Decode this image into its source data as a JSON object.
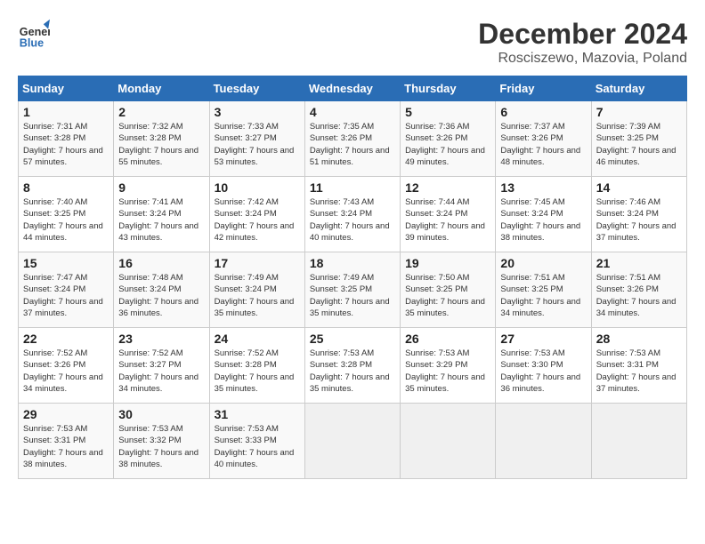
{
  "header": {
    "logo_line1": "General",
    "logo_line2": "Blue",
    "month": "December 2024",
    "location": "Rosciszewo, Mazovia, Poland"
  },
  "weekdays": [
    "Sunday",
    "Monday",
    "Tuesday",
    "Wednesday",
    "Thursday",
    "Friday",
    "Saturday"
  ],
  "weeks": [
    [
      {
        "day": "1",
        "sunrise": "7:31 AM",
        "sunset": "3:28 PM",
        "daylight": "7 hours and 57 minutes."
      },
      {
        "day": "2",
        "sunrise": "7:32 AM",
        "sunset": "3:28 PM",
        "daylight": "7 hours and 55 minutes."
      },
      {
        "day": "3",
        "sunrise": "7:33 AM",
        "sunset": "3:27 PM",
        "daylight": "7 hours and 53 minutes."
      },
      {
        "day": "4",
        "sunrise": "7:35 AM",
        "sunset": "3:26 PM",
        "daylight": "7 hours and 51 minutes."
      },
      {
        "day": "5",
        "sunrise": "7:36 AM",
        "sunset": "3:26 PM",
        "daylight": "7 hours and 49 minutes."
      },
      {
        "day": "6",
        "sunrise": "7:37 AM",
        "sunset": "3:26 PM",
        "daylight": "7 hours and 48 minutes."
      },
      {
        "day": "7",
        "sunrise": "7:39 AM",
        "sunset": "3:25 PM",
        "daylight": "7 hours and 46 minutes."
      }
    ],
    [
      {
        "day": "8",
        "sunrise": "7:40 AM",
        "sunset": "3:25 PM",
        "daylight": "7 hours and 44 minutes."
      },
      {
        "day": "9",
        "sunrise": "7:41 AM",
        "sunset": "3:24 PM",
        "daylight": "7 hours and 43 minutes."
      },
      {
        "day": "10",
        "sunrise": "7:42 AM",
        "sunset": "3:24 PM",
        "daylight": "7 hours and 42 minutes."
      },
      {
        "day": "11",
        "sunrise": "7:43 AM",
        "sunset": "3:24 PM",
        "daylight": "7 hours and 40 minutes."
      },
      {
        "day": "12",
        "sunrise": "7:44 AM",
        "sunset": "3:24 PM",
        "daylight": "7 hours and 39 minutes."
      },
      {
        "day": "13",
        "sunrise": "7:45 AM",
        "sunset": "3:24 PM",
        "daylight": "7 hours and 38 minutes."
      },
      {
        "day": "14",
        "sunrise": "7:46 AM",
        "sunset": "3:24 PM",
        "daylight": "7 hours and 37 minutes."
      }
    ],
    [
      {
        "day": "15",
        "sunrise": "7:47 AM",
        "sunset": "3:24 PM",
        "daylight": "7 hours and 37 minutes."
      },
      {
        "day": "16",
        "sunrise": "7:48 AM",
        "sunset": "3:24 PM",
        "daylight": "7 hours and 36 minutes."
      },
      {
        "day": "17",
        "sunrise": "7:49 AM",
        "sunset": "3:24 PM",
        "daylight": "7 hours and 35 minutes."
      },
      {
        "day": "18",
        "sunrise": "7:49 AM",
        "sunset": "3:25 PM",
        "daylight": "7 hours and 35 minutes."
      },
      {
        "day": "19",
        "sunrise": "7:50 AM",
        "sunset": "3:25 PM",
        "daylight": "7 hours and 35 minutes."
      },
      {
        "day": "20",
        "sunrise": "7:51 AM",
        "sunset": "3:25 PM",
        "daylight": "7 hours and 34 minutes."
      },
      {
        "day": "21",
        "sunrise": "7:51 AM",
        "sunset": "3:26 PM",
        "daylight": "7 hours and 34 minutes."
      }
    ],
    [
      {
        "day": "22",
        "sunrise": "7:52 AM",
        "sunset": "3:26 PM",
        "daylight": "7 hours and 34 minutes."
      },
      {
        "day": "23",
        "sunrise": "7:52 AM",
        "sunset": "3:27 PM",
        "daylight": "7 hours and 34 minutes."
      },
      {
        "day": "24",
        "sunrise": "7:52 AM",
        "sunset": "3:28 PM",
        "daylight": "7 hours and 35 minutes."
      },
      {
        "day": "25",
        "sunrise": "7:53 AM",
        "sunset": "3:28 PM",
        "daylight": "7 hours and 35 minutes."
      },
      {
        "day": "26",
        "sunrise": "7:53 AM",
        "sunset": "3:29 PM",
        "daylight": "7 hours and 35 minutes."
      },
      {
        "day": "27",
        "sunrise": "7:53 AM",
        "sunset": "3:30 PM",
        "daylight": "7 hours and 36 minutes."
      },
      {
        "day": "28",
        "sunrise": "7:53 AM",
        "sunset": "3:31 PM",
        "daylight": "7 hours and 37 minutes."
      }
    ],
    [
      {
        "day": "29",
        "sunrise": "7:53 AM",
        "sunset": "3:31 PM",
        "daylight": "7 hours and 38 minutes."
      },
      {
        "day": "30",
        "sunrise": "7:53 AM",
        "sunset": "3:32 PM",
        "daylight": "7 hours and 38 minutes."
      },
      {
        "day": "31",
        "sunrise": "7:53 AM",
        "sunset": "3:33 PM",
        "daylight": "7 hours and 40 minutes."
      },
      null,
      null,
      null,
      null
    ]
  ]
}
